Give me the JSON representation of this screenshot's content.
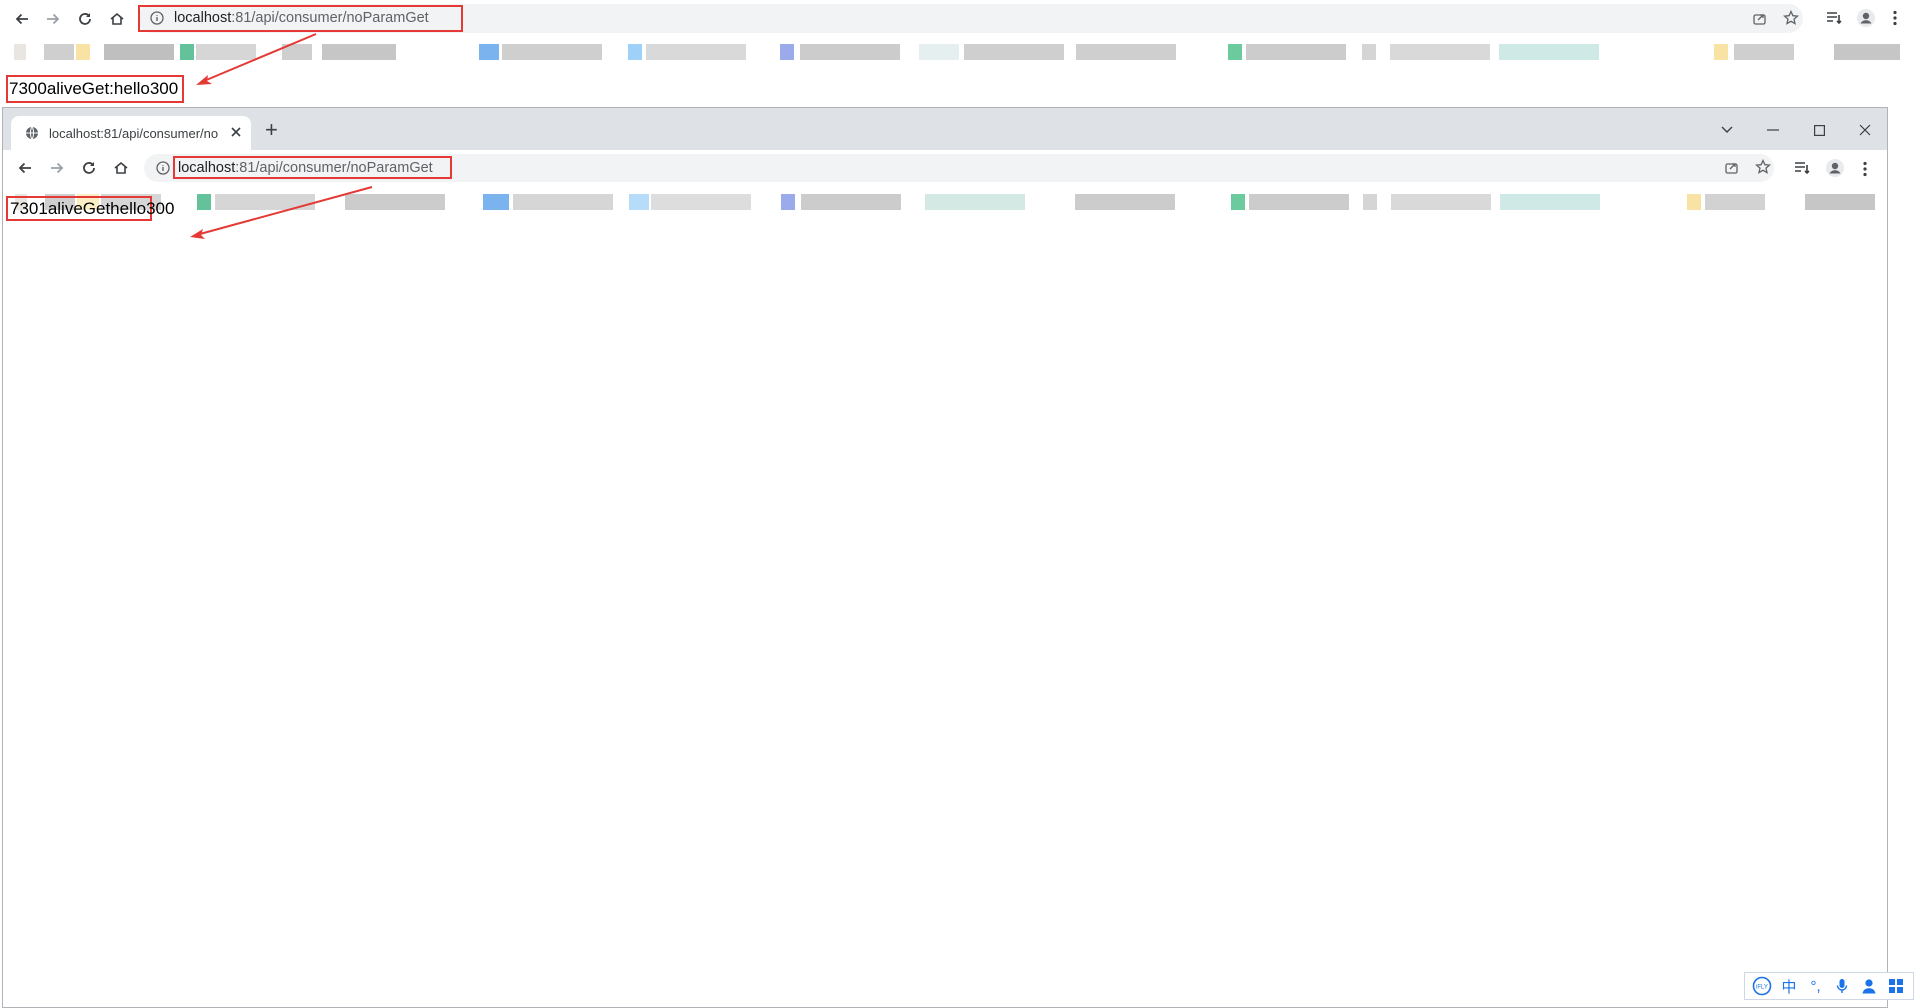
{
  "background_window": {
    "address_bar": {
      "host": "localhost",
      "rest": ":81/api/consumer/noParamGet"
    },
    "page_text": "7300aliveGet:hello300"
  },
  "foreground_window": {
    "tab": {
      "title": "localhost:81/api/consumer/no",
      "new_tab_symbol": "+"
    },
    "address_bar": {
      "host": "localhost",
      "rest": ":81/api/consumer/noParamGet"
    },
    "page_text": "7301aliveGethello300"
  },
  "ime": {
    "items": [
      "iFLY",
      "中",
      "°,",
      "mic",
      "user",
      "grid"
    ],
    "chinese_label": "中",
    "punct_label": "°,"
  },
  "colors": {
    "annotation_red": "#e53935",
    "omnibox_bg": "#f1f3f4",
    "titlebar_bg": "#dee1e6",
    "ime_blue": "#1a73e8"
  },
  "icons": {
    "back": "arrow-left-icon",
    "forward": "arrow-right-icon",
    "reload": "reload-icon",
    "home": "home-icon",
    "site_info": "info-circle-icon",
    "share": "share-icon",
    "bookmark": "star-icon",
    "reading_list": "reading-list-icon",
    "profile": "profile-icon",
    "menu": "kebab-menu-icon",
    "globe": "globe-icon",
    "close": "close-icon",
    "tab_search": "chevron-down-icon",
    "minimize": "minimize-icon",
    "maximize": "maximize-icon"
  }
}
